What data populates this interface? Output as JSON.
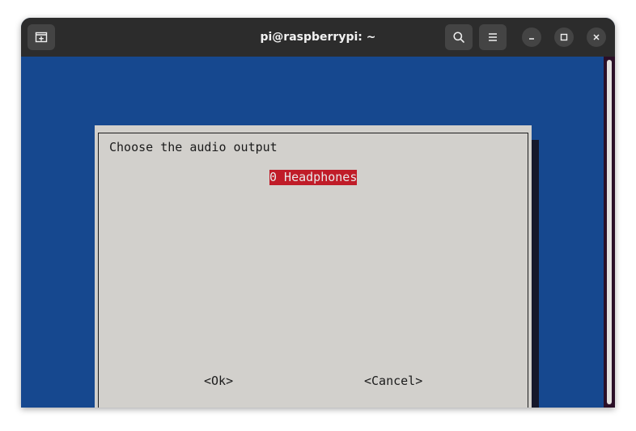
{
  "window": {
    "title": "pi@raspberrypi: ~"
  },
  "icons": {
    "new_tab": "new-tab-icon",
    "search": "search-icon",
    "menu": "hamburger-menu-icon",
    "minimize": "minimize-icon",
    "maximize": "maximize-icon",
    "close": "close-icon"
  },
  "dialog": {
    "prompt": "Choose the audio output",
    "options": [
      {
        "label": "0 Headphones",
        "selected": true
      }
    ],
    "ok_label": "<Ok>",
    "cancel_label": "<Cancel>"
  },
  "colors": {
    "terminal_background": "#16488f",
    "dialog_background": "#d2d0cc",
    "selection": "#c01c28",
    "titlebar": "#2c2c2c"
  }
}
